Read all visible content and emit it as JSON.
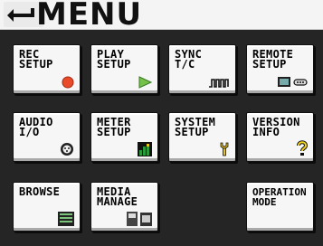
{
  "header": {
    "title": "MENU",
    "back_icon": "return-arrow-icon"
  },
  "buttons": [
    {
      "label": "REC\nSETUP",
      "icon": "record-dot-icon"
    },
    {
      "label": "PLAY\nSETUP",
      "icon": "play-triangle-icon"
    },
    {
      "label": "SYNC\nT/C",
      "icon": "timecode-waveform-icon"
    },
    {
      "label": "REMOTE\nSETUP",
      "icon": "remote-device-icon"
    },
    {
      "label": "AUDIO\nI/O",
      "icon": "xlr-connector-icon"
    },
    {
      "label": "METER\nSETUP",
      "icon": "level-meter-icon"
    },
    {
      "label": "SYSTEM\nSETUP",
      "icon": "wrench-icon"
    },
    {
      "label": "VERSION\nINFO",
      "icon": "question-mark-icon"
    },
    {
      "label": "BROWSE",
      "icon": "file-list-icon"
    },
    {
      "label": "MEDIA\nMANAGE",
      "icon": "usb-cf-media-icon"
    },
    {
      "label": "OPERATION\nMODE",
      "icon": ""
    }
  ],
  "colors": {
    "record": "#e84a2a",
    "play": "#74c24a",
    "meter": "#2a9a3a",
    "wrench": "#e7c21f",
    "question": "#f2d21f"
  }
}
